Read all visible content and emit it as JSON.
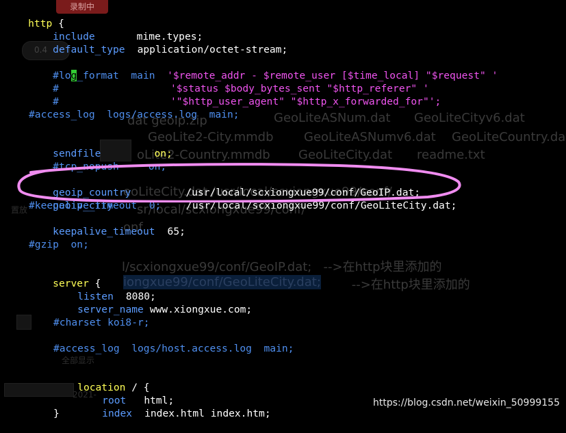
{
  "ghost": {
    "badge": "录制中",
    "zoom_label": "0.4",
    "files": [
      "GeoLiteASNum.dat",
      "GeoLiteCityv6.dat",
      "GeoLite2-City.mmdb",
      "GeoLiteASNumv6.dat",
      "GeoLiteCountry.dat",
      "oLite2-Country.mmdb",
      "GeoLiteCity.dat",
      "readme.txt"
    ],
    "partial1": "dat geoip.zip",
    "partial2": "eoLiteCity.dat /usr/local/scxiongxue99/conf/",
    "partial3": "sr/local/scxiongxue99/conf/",
    "partial4": "onf",
    "note1": "l/scxiongxue99/conf/GeoIP.dat;   -->在http块里添加的",
    "note2": "iongxue99/conf/GeoLiteCity.dat;",
    "note2_tail": " -->在http块里添加的",
    "side1": "置放",
    "side2": "全部显示",
    "side3": "2021-"
  },
  "terminal": {
    "lines": [
      {
        "t": "http",
        "c": "kw"
      },
      {
        "t": "include",
        "c": "dir",
        "v": "mime.types;"
      },
      {
        "t": "default_type",
        "c": "dir",
        "v": "application/octet-stream;"
      },
      {
        "t": "log_format_line1",
        "c": "cm"
      },
      {
        "t": "log_format_line2",
        "c": "cm"
      },
      {
        "t": "log_format_line3",
        "c": "cm"
      }
    ],
    "http_kw": "http",
    "brace": " {",
    "include_kw": "include",
    "include_val": "mime.types;",
    "default_type_kw": "default_type",
    "default_type_val": "application/octet-stream;",
    "lf1_a": "#lo",
    "lf1_cursor": "g",
    "lf1_b": "_format  main  ",
    "lf1_str": "'$remote_addr - $remote_user [$time_local] \"$request\" '",
    "lf2_hash": "#",
    "lf2_str": "'$status $body_bytes_sent \"$http_referer\" '",
    "lf3_hash": "#",
    "lf3_str": "'\"$http_user_agent\" \"$http_x_forwarded_for\"';",
    "access_log": "#access_log  logs/access.log  main;",
    "sendfile_kw": "sendfile",
    "sendfile_val": "on;",
    "tcp_nopush_kw": "#tcp_nopush",
    "tcp_nopush_val": "on;",
    "geoip_country_kw": "geoip_country",
    "geoip_country_val": "/usr/local/scxiongxue99/conf/GeoIP.dat;",
    "geoip_city_kw": "geoip_city",
    "geoip_city_val": "/usr/local/scxiongxue99/conf/GeoLiteCity.dat;",
    "keepalive_cm": "#keepalive_timeout  0;",
    "keepalive_kw": "keepalive_timeout",
    "keepalive_val": "65;",
    "gzip": "#gzip  on;",
    "server_kw": "server",
    "listen_kw": "listen",
    "listen_val": "8080;",
    "server_name_kw": "server_name",
    "server_name_val": "www.xiongxue.com;",
    "charset": "#charset koi8-r;",
    "host_access_log": "#access_log  logs/host.access.log  main;",
    "location_kw": "location",
    "location_val": " / {",
    "root_kw": "root",
    "root_val": "html;",
    "index_kw": "index",
    "index_val": "index.html index.htm;",
    "close_brace": "}"
  },
  "watermark": "https://blog.csdn.net/weixin_50999155",
  "colors": {
    "background": "#000000",
    "keyword": "#ffff57",
    "directive": "#5c9cff",
    "comment": "#4f8fef",
    "string": "#ef54ef",
    "annotation": "#f08cf0"
  }
}
